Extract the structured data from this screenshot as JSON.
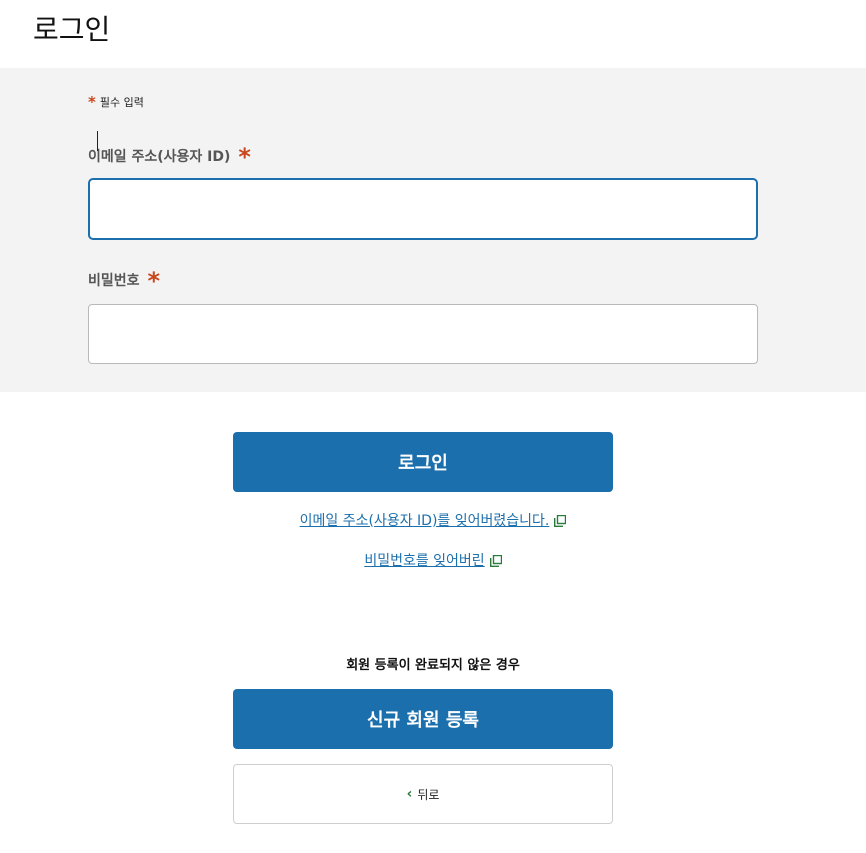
{
  "page": {
    "title": "로그인"
  },
  "form": {
    "required_note": "필수 입력",
    "required_marker": "*",
    "email": {
      "label": "이메일 주소(사용자 ID)",
      "value": "",
      "placeholder": ""
    },
    "password": {
      "label": "비밀번호",
      "value": "",
      "placeholder": ""
    }
  },
  "actions": {
    "login_label": "로그인",
    "forgot_email_link": "이메일 주소(사용자 ID)를 잊어버렸습니다.",
    "forgot_password_link": "비밀번호를 잊어버린"
  },
  "register": {
    "note": "회원 등록이 완료되지 않은 경우",
    "button_label": "신규 회원 등록"
  },
  "back": {
    "label": "뒤로",
    "icon": "chevron-left-icon"
  },
  "colors": {
    "primary": "#1c6fad",
    "required": "#c8471b",
    "panel_bg": "#f3f3f3"
  }
}
